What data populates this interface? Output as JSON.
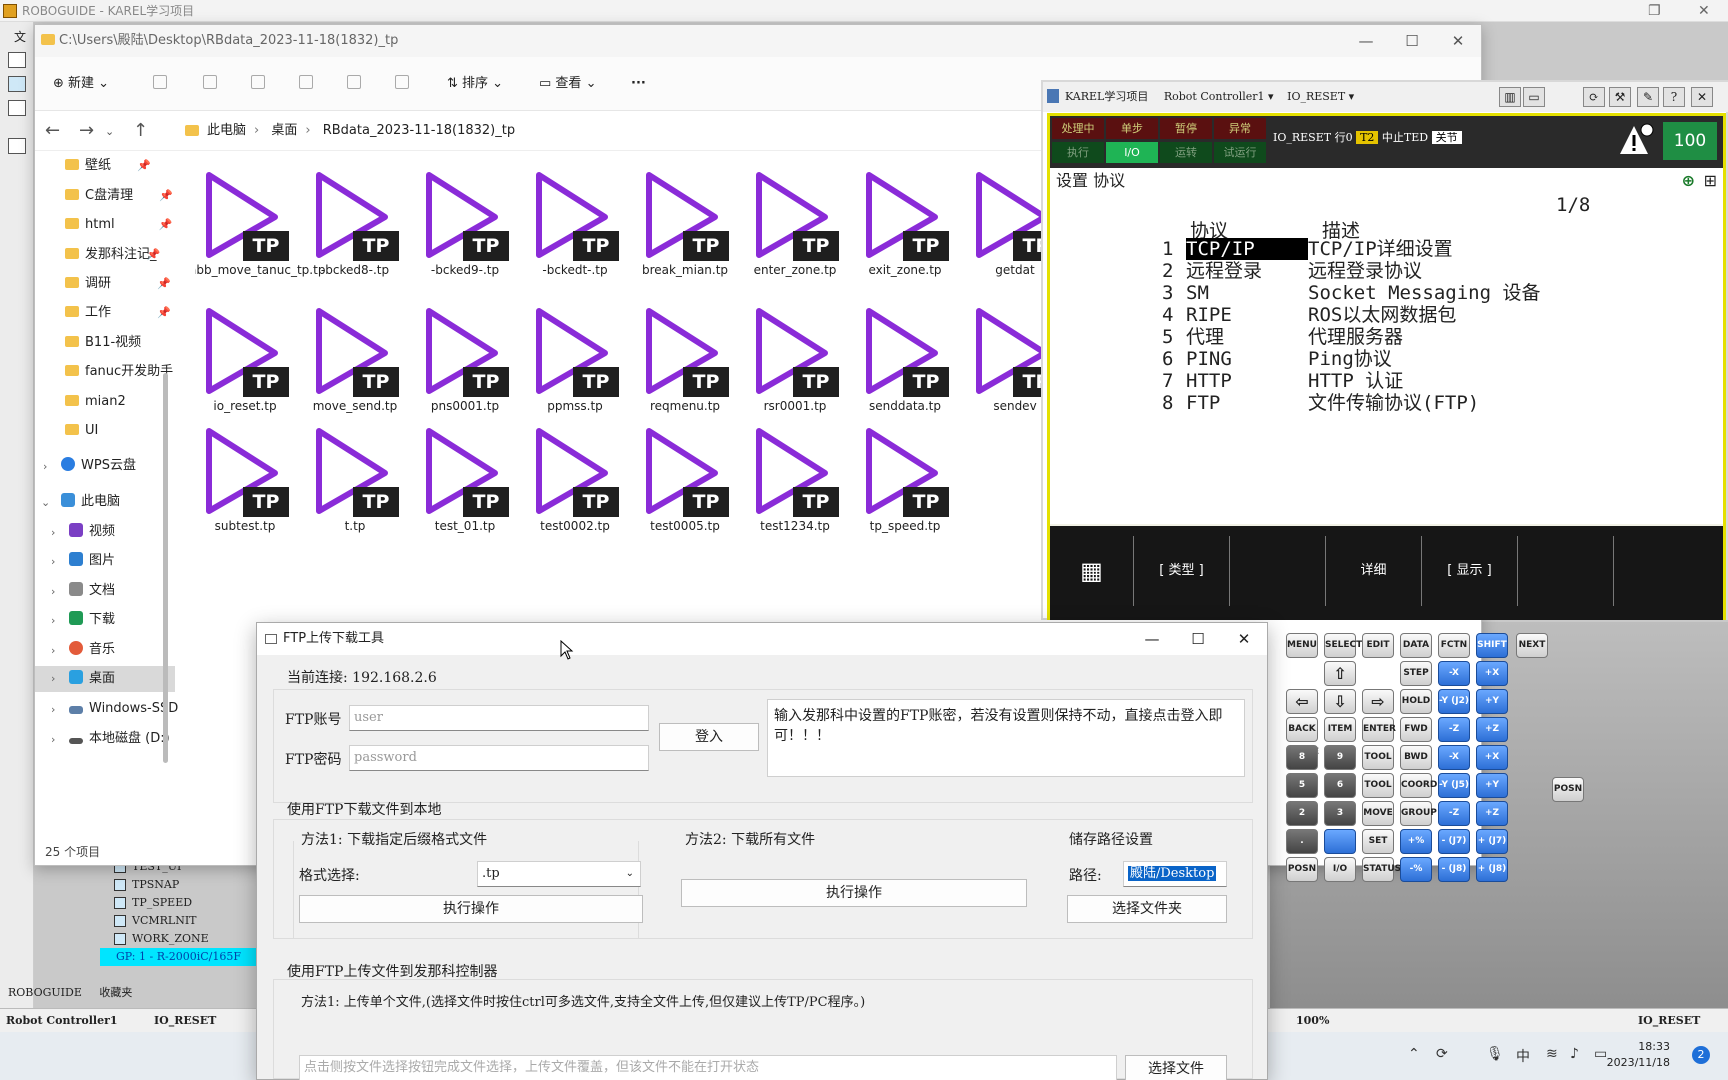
{
  "roboguide": {
    "title": "ROBOGUIDE - KAREL学习项目",
    "menu_first": "文",
    "tree": [
      "TEST_UI",
      "TPSNAP",
      "TP_SPEED",
      "VCMRLNIT",
      "WORK_ZONE",
      "GP: 1 - R-2000iC/165F"
    ],
    "bottom_tabs": [
      "ROBOGUIDE",
      "收藏夹"
    ],
    "status_left_a": "Robot Controller1",
    "status_left_b": "IO_RESET",
    "status_zoom": "100%",
    "status_right": "IO_RESET"
  },
  "explorer": {
    "title": "C:\\Users\\殿陆\\Desktop\\RBdata_2023-11-18(1832)_tp",
    "toolbar": {
      "new": "新建",
      "sort": "排序",
      "view": "查看",
      "more": "···"
    },
    "breadcrumb": [
      "此电脑",
      "桌面",
      "RBdata_2023-11-18(1832)_tp"
    ],
    "sidebar": [
      {
        "label": "壁纸",
        "pin": true
      },
      {
        "label": "C盘清理",
        "pin": true
      },
      {
        "label": "html",
        "pin": true
      },
      {
        "label": "发那科注记_",
        "pin": true
      },
      {
        "label": "调研",
        "pin": true
      },
      {
        "label": "工作",
        "pin": true
      },
      {
        "label": "B11-视频",
        "pin": false
      },
      {
        "label": "fanuc开发助手",
        "pin": false
      },
      {
        "label": "mian2",
        "pin": false
      },
      {
        "label": "UI",
        "pin": false
      }
    ],
    "sidebar_tree": [
      "WPS云盘",
      "此电脑",
      "视频",
      "图片",
      "文档",
      "下载",
      "音乐",
      "桌面",
      "Windows-SSD",
      "本地磁盘 (D:)"
    ],
    "item_count": "25 个项目",
    "badge": "TP",
    "files": [
      "abb_move_tanuc_tp.tp",
      "-bcked8-.tp",
      "-bcked9-.tp",
      "-bckedt-.tp",
      "break_mian.tp",
      "enter_zone.tp",
      "exit_zone.tp",
      "getdat",
      "io_reset.tp",
      "move_send.tp",
      "pns0001.tp",
      "ppmss.tp",
      "reqmenu.tp",
      "rsr0001.tp",
      "senddata.tp",
      "sendev",
      "subtest.tp",
      "t.tp",
      "test_01.tp",
      "test0002.tp",
      "test0005.tp",
      "test1234.tp",
      "tp_speed.tp"
    ]
  },
  "pendant": {
    "title": "KAREL学习项目",
    "controller": "Robot Controller1",
    "program": "IO_RESET",
    "indicators_top": [
      "处理中",
      "单步",
      "暂停",
      "异常"
    ],
    "indicators_bottom": [
      "执行",
      "I/O",
      "运转",
      "试运行"
    ],
    "status_line": {
      "prog": "IO_RESET",
      "line": "行0",
      "mode": "T2",
      "state": "中止TED",
      "joint": "关节"
    },
    "override": "100",
    "header": "设置 协议",
    "page": "1/8",
    "col_protocol": "协议",
    "col_desc": "描述",
    "rows": [
      {
        "n": "1",
        "name": "TCP/IP",
        "desc": "TCP/IP详细设置"
      },
      {
        "n": "2",
        "name": "远程登录",
        "desc": "远程登录协议"
      },
      {
        "n": "3",
        "name": "SM",
        "desc": "Socket Messaging 设备"
      },
      {
        "n": "4",
        "name": "RIPE",
        "desc": "ROS以太网数据包"
      },
      {
        "n": "5",
        "name": "代理",
        "desc": "代理服务器"
      },
      {
        "n": "6",
        "name": "PING",
        "desc": "Ping协议"
      },
      {
        "n": "7",
        "name": "HTTP",
        "desc": "HTTP 认证"
      },
      {
        "n": "8",
        "name": "FTP",
        "desc": "文件传输协议(FTP)"
      }
    ],
    "softkeys": [
      "",
      "[ 类型 ]",
      "",
      "详细",
      "[ 显示 ]",
      "",
      ""
    ]
  },
  "keypad": {
    "keys": [
      "MENU",
      "SELECT",
      "EDIT",
      "DATA",
      "FCTN",
      "SHIFT",
      "NEXT",
      "STEP",
      "-X (J1)",
      "+X (J1)",
      "HOLD",
      "-Y (J2)",
      "+Y (J2)",
      "BACK SPACE",
      "ITEM",
      "ENTER",
      "FWD",
      "-Z (J3)",
      "+Z (J3)",
      "8",
      "9",
      "TOOL 1",
      "BWD",
      "-X (J4)",
      "+X (J4)",
      "5",
      "6",
      "TOOL 2",
      "COORD",
      "-Y (J5)",
      "+Y (J5)",
      "2",
      "3",
      "MOVE MENU",
      "GROUP",
      "-Z (J6)",
      "+Z (J6)",
      ".",
      "",
      "SET UP",
      "+%",
      "- (J7)",
      "+ (J7)",
      "POSN",
      "I/O",
      "STATUS",
      "-%",
      "- (J8)",
      "+ (J8)",
      "POSN"
    ]
  },
  "ftp": {
    "title": "FTP上传下载工具",
    "connection": "当前连接: 192.168.2.6",
    "account_label": "FTP账号",
    "account_placeholder": "user",
    "password_label": "FTP密码",
    "password_placeholder": "password",
    "login": "登入",
    "hint": "输入发那科中设置的FTP账密，若没有设置则保持不动，直接点击登入即可！！！",
    "download_section": "使用FTP下载文件到本地",
    "method1": "方法1: 下载指定后缀格式文件",
    "format_label": "格式选择:",
    "format_value": ".tp",
    "execute1": "执行操作",
    "method2": "方法2: 下载所有文件",
    "execute2": "执行操作",
    "path_section": "储存路径设置",
    "path_label": "路径:",
    "path_value": "殿陆/Desktop",
    "choose_folder": "选择文件夹",
    "upload_section": "使用FTP上传文件到发那科控制器",
    "upload_method1": "方法1: 上传单个文件,(选择文件时按住ctrl可多选文件,支持全文件上传,但仅建议上传TP/PC程序。)",
    "upload_hint": "点击侧按文件选择按钮完成文件选择，上传文件覆盖，但该文件不能在打开状态",
    "choose_file": "选择文件"
  },
  "taskbar": {
    "clock_time": "18:33",
    "clock_date": "2023/11/18",
    "notifications": "2"
  }
}
